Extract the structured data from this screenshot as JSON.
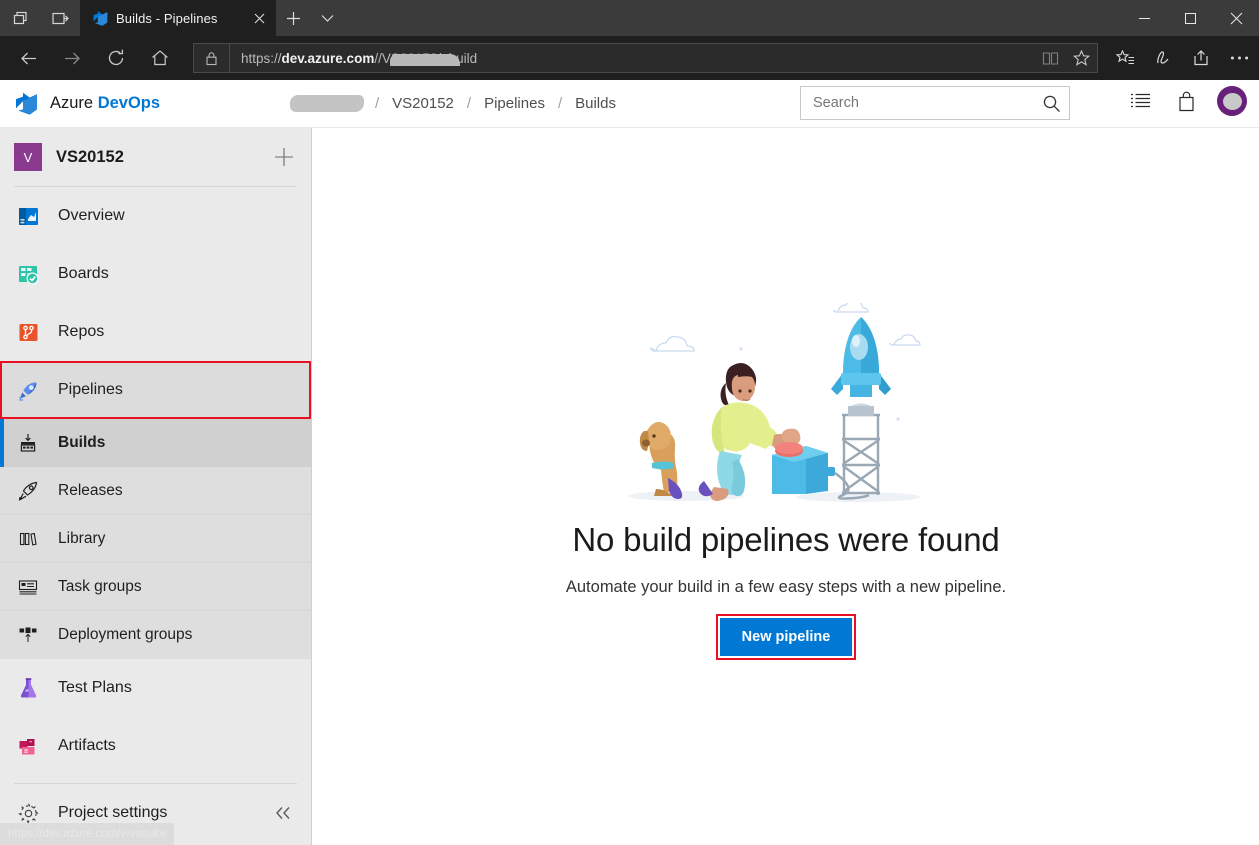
{
  "browser": {
    "tab": {
      "title": "Builds - Pipelines",
      "favicon_icon": "azure-devops-favicon",
      "close_icon": "close-icon"
    },
    "tabstrip_buttons": [
      {
        "name": "show-tab-previews-icon"
      },
      {
        "name": "set-tabs-aside-icon"
      }
    ],
    "new_tab_icon": "plus-icon",
    "tab_list_icon": "chevron-down-icon",
    "window_controls": [
      {
        "name": "minimize-icon",
        "glyph": "—"
      },
      {
        "name": "maximize-icon",
        "glyph": "□"
      },
      {
        "name": "close-window-icon",
        "glyph": "✕"
      }
    ],
    "nav": {
      "back_icon": "back-arrow-icon",
      "forward_icon": "forward-arrow-icon",
      "refresh_icon": "refresh-icon",
      "home_icon": "home-icon"
    },
    "address": {
      "lock_icon": "lock-icon",
      "url_prefix": "https://",
      "url_domain": "dev.azure.com",
      "url_separator": "/",
      "url_suffix": "/VS20152/_build",
      "redacted": true,
      "reading_view_icon": "reading-view-icon",
      "favorite_icon": "star-icon"
    },
    "toolbar_icons": [
      {
        "name": "favorites-hub-icon"
      },
      {
        "name": "notes-pen-icon"
      },
      {
        "name": "share-icon"
      },
      {
        "name": "settings-more-icon"
      }
    ]
  },
  "ado": {
    "brand_prefix": "Azure ",
    "brand_suffix": "DevOps",
    "logo_icon": "azure-devops-logo",
    "breadcrumb": {
      "org_redacted": true,
      "items": [
        {
          "label": "VS20152"
        },
        {
          "label": "Pipelines"
        },
        {
          "label": "Builds"
        }
      ],
      "separator": "/"
    },
    "search": {
      "placeholder": "Search",
      "value": "",
      "icon": "search-icon"
    },
    "header_icons": [
      {
        "name": "work-items-list-icon"
      },
      {
        "name": "marketplace-bag-icon"
      }
    ],
    "avatar_name": "user-avatar"
  },
  "sidebar": {
    "project": {
      "initial": "V",
      "name": "VS20152",
      "add_icon": "plus-icon"
    },
    "items": [
      {
        "label": "Overview",
        "icon": "overview-icon",
        "state": "normal"
      },
      {
        "label": "Boards",
        "icon": "boards-icon",
        "state": "normal"
      },
      {
        "label": "Repos",
        "icon": "repos-icon",
        "state": "normal"
      },
      {
        "label": "Pipelines",
        "icon": "pipelines-icon",
        "state": "highlighted"
      }
    ],
    "sub_items": [
      {
        "label": "Builds",
        "icon": "builds-icon",
        "state": "selected"
      },
      {
        "label": "Releases",
        "icon": "releases-rocket-icon",
        "state": "normal"
      },
      {
        "label": "Library",
        "icon": "library-icon",
        "state": "normal"
      },
      {
        "label": "Task groups",
        "icon": "task-groups-icon",
        "state": "normal"
      },
      {
        "label": "Deployment groups",
        "icon": "deployment-groups-icon",
        "state": "normal"
      }
    ],
    "items_after": [
      {
        "label": "Test Plans",
        "icon": "test-plans-icon",
        "state": "normal"
      },
      {
        "label": "Artifacts",
        "icon": "artifacts-icon",
        "state": "normal"
      }
    ],
    "settings": {
      "label": "Project settings",
      "icon": "gear-icon",
      "collapse_icon": "double-chevron-left-icon"
    }
  },
  "statusbar": {
    "url": "https://dev.azure.com/v-vasuke"
  },
  "main": {
    "illustration_name": "build-pipeline-launch-illustration",
    "title": "No build pipelines were found",
    "subtitle": "Automate your build in a few easy steps with a new pipeline.",
    "primary_button": "New pipeline"
  },
  "colors": {
    "accent_blue": "#0078d4",
    "highlight_red": "#e81123",
    "brand_purple": "#68217a",
    "sidebar_bg": "#eaeaea",
    "submenu_bg": "#dedede",
    "selected_bg": "#d0d0d0",
    "chrome_dark": "#1f1f1f",
    "tabstrip_dark": "#3b3b3b"
  }
}
